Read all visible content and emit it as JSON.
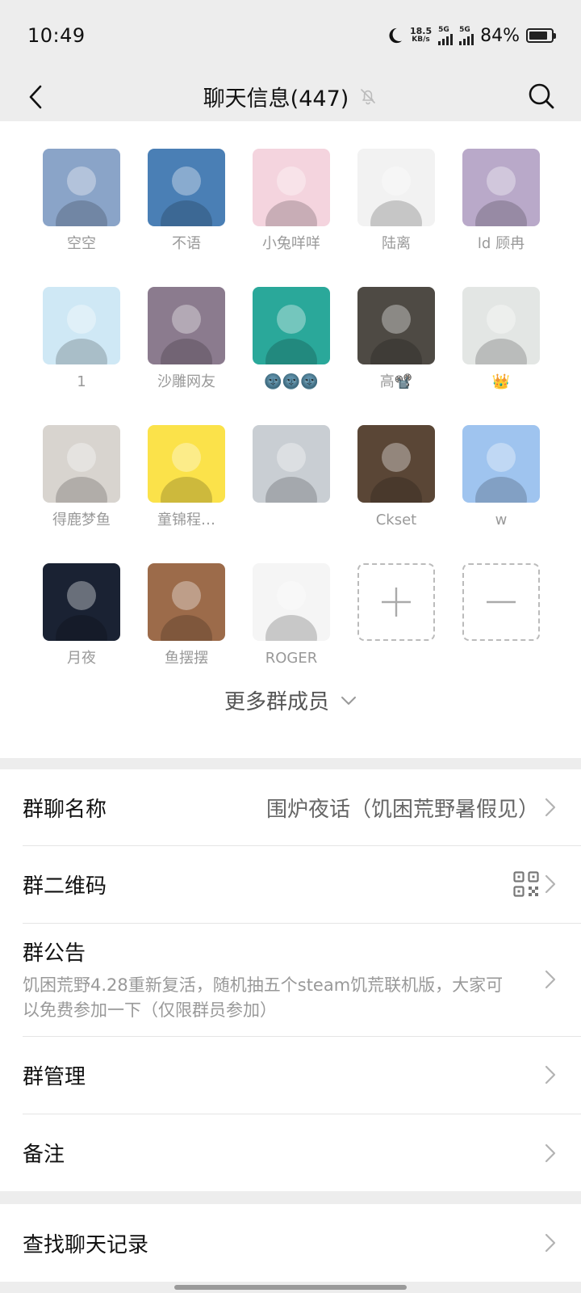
{
  "status": {
    "time": "10:49",
    "net_speed_top": "18.5",
    "net_speed_bottom": "KB/s",
    "sim1": "5G",
    "sim2": "5G",
    "battery_text": "84%",
    "battery_level": 0.84
  },
  "header": {
    "title": "聊天信息(447)",
    "back_icon": "chevron-left-icon",
    "mute_icon": "bell-off-icon",
    "search_icon": "search-icon"
  },
  "members": [
    {
      "name": "空空",
      "color": "#8aa4c8"
    },
    {
      "name": "不语",
      "color": "#4a7fb5"
    },
    {
      "name": "小兔咩咩",
      "color": "#f4d4de"
    },
    {
      "name": "陆离",
      "color": "#f2f2f2"
    },
    {
      "name": "ld 顾冉",
      "color": "#b9a9c9"
    },
    {
      "name": "1",
      "color": "#cfe8f5"
    },
    {
      "name": "沙雕网友",
      "color": "#8b7b8e"
    },
    {
      "name": "🌚🌚🌚",
      "color": "#2aa89a"
    },
    {
      "name": "高📽️",
      "color": "#4e4a44"
    },
    {
      "name": "👑",
      "color": "#e3e6e4"
    },
    {
      "name": "得鹿梦鱼",
      "color": "#d8d4cf"
    },
    {
      "name": "童锦程…",
      "color": "#fbe24a"
    },
    {
      "name": "",
      "color": "#c9ced3"
    },
    {
      "name": "Ckset",
      "color": "#5a4636"
    },
    {
      "name": "w",
      "color": "#9fc4ef"
    },
    {
      "name": "月夜",
      "color": "#1a2233"
    },
    {
      "name": "鱼摆摆",
      "color": "#9c6b4a"
    },
    {
      "name": "ROGER",
      "color": "#f5f5f5"
    }
  ],
  "more_members": "更多群成员",
  "settings": {
    "group_name_label": "群聊名称",
    "group_name_value": "围炉夜话（饥困荒野暑假见）",
    "qr_label": "群二维码",
    "notice_label": "群公告",
    "notice_text": "饥困荒野4.28重新复活，随机抽五个steam饥荒联机版，大家可以免费参加一下（仅限群员参加）",
    "manage_label": "群管理",
    "remark_label": "备注",
    "search_history_label": "查找聊天记录"
  }
}
